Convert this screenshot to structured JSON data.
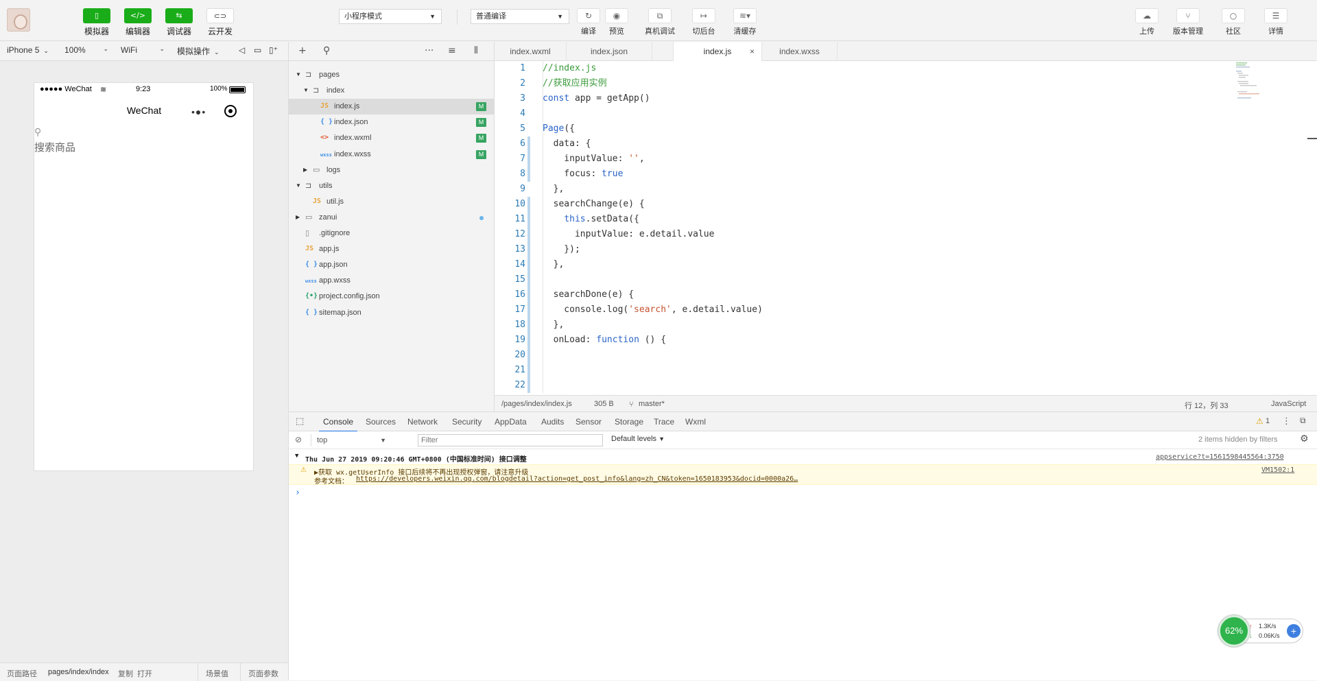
{
  "toolbar": {
    "left_buttons": [
      "模拟器",
      "编辑器",
      "调试器",
      "云开发"
    ],
    "mode_select": "小程序模式",
    "compile_select": "普通编译",
    "mid_buttons": [
      "编译",
      "预览",
      "真机调试",
      "切后台",
      "清缓存"
    ],
    "right_buttons": [
      "上传",
      "版本管理",
      "社区",
      "详情"
    ]
  },
  "simbar": {
    "device": "iPhone 5",
    "zoom": "100%",
    "network": "WiFi",
    "ops": "模拟操作"
  },
  "phone": {
    "carrier": "●●●●● WeChat",
    "time": "9:23",
    "battery": "100%",
    "nav_title": "WeChat",
    "search_placeholder": "搜索商品"
  },
  "bottom": {
    "path_label": "页面路径",
    "path": "pages/index/index",
    "copy": "复制",
    "open": "打开",
    "scene": "场景值",
    "params": "页面参数"
  },
  "files": [
    {
      "name": "pages",
      "type": "folder-open",
      "depth": 0,
      "tri": "▼"
    },
    {
      "name": "index",
      "type": "folder-open",
      "depth": 1,
      "tri": "▼"
    },
    {
      "name": "index.js",
      "type": "js",
      "depth": 2,
      "badge": "M",
      "active": true
    },
    {
      "name": "index.json",
      "type": "json",
      "depth": 2,
      "badge": "M"
    },
    {
      "name": "index.wxml",
      "type": "wxml",
      "depth": 2,
      "badge": "M"
    },
    {
      "name": "index.wxss",
      "type": "wxss",
      "depth": 2,
      "badge": "M"
    },
    {
      "name": "logs",
      "type": "folder",
      "depth": 1,
      "tri": "▶"
    },
    {
      "name": "utils",
      "type": "folder-open",
      "depth": 0,
      "tri": "▼"
    },
    {
      "name": "util.js",
      "type": "js",
      "depth": 1
    },
    {
      "name": "zanui",
      "type": "folder",
      "depth": 0,
      "tri": "▶",
      "dot": true
    },
    {
      "name": ".gitignore",
      "type": "file",
      "depth": 0
    },
    {
      "name": "app.js",
      "type": "js",
      "depth": 0
    },
    {
      "name": "app.json",
      "type": "json",
      "depth": 0
    },
    {
      "name": "app.wxss",
      "type": "wxss",
      "depth": 0
    },
    {
      "name": "project.config.json",
      "type": "config",
      "depth": 0
    },
    {
      "name": "sitemap.json",
      "type": "json",
      "depth": 0
    }
  ],
  "tabs": [
    "index.wxml",
    "index.json",
    "index.js",
    "index.wxss"
  ],
  "active_tab": "index.js",
  "code_lines": [
    {
      "n": "1",
      "t": "//index.js",
      "k": "cm"
    },
    {
      "n": "2",
      "t": "//获取应用实例",
      "k": "cm"
    },
    {
      "n": "3",
      "t": "const app = getApp()",
      "k": "mix"
    },
    {
      "n": "4",
      "t": "",
      "k": ""
    },
    {
      "n": "5",
      "t": "Page({",
      "k": "kw"
    },
    {
      "n": "6",
      "t": "  data: {",
      "k": ""
    },
    {
      "n": "7",
      "t": "    inputValue: '',",
      "k": ""
    },
    {
      "n": "8",
      "t": "    focus: true",
      "k": ""
    },
    {
      "n": "9",
      "t": "  },",
      "k": ""
    },
    {
      "n": "10",
      "t": "  searchChange(e) {",
      "k": ""
    },
    {
      "n": "11",
      "t": "    this.setData({",
      "k": ""
    },
    {
      "n": "12",
      "t": "      inputValue: e.detail.value",
      "k": ""
    },
    {
      "n": "13",
      "t": "    });",
      "k": ""
    },
    {
      "n": "14",
      "t": "  },",
      "k": ""
    },
    {
      "n": "15",
      "t": "",
      "k": ""
    },
    {
      "n": "16",
      "t": "  searchDone(e) {",
      "k": ""
    },
    {
      "n": "17",
      "t": "    console.log('search', e.detail.value)",
      "k": ""
    },
    {
      "n": "18",
      "t": "  },",
      "k": ""
    },
    {
      "n": "19",
      "t": "  onLoad: function () {",
      "k": ""
    },
    {
      "n": "20",
      "t": "",
      "k": ""
    },
    {
      "n": "21",
      "t": "",
      "k": ""
    },
    {
      "n": "22",
      "t": "",
      "k": ""
    }
  ],
  "editor_status": {
    "path": "/pages/index/index.js",
    "size": "305 B",
    "branch": "master*",
    "position": "行 12，列 33",
    "language": "JavaScript"
  },
  "devtools": {
    "tabs": [
      "Console",
      "Sources",
      "Network",
      "Security",
      "AppData",
      "Audits",
      "Sensor",
      "Storage",
      "Trace",
      "Wxml"
    ],
    "active_tab": "Console",
    "warn_count": "1",
    "context": "top",
    "filter_placeholder": "Filter",
    "levels": "Default levels",
    "hidden": "2 items hidden by filters",
    "group_line": "Thu Jun 27 2019 09:20:46 GMT+0800 (中国标准时间) 接口调整",
    "group_source": "appservice?t=1561598445564:3750",
    "warn_line1": "▶获取 wx.getUserInfo 接口后续将不再出现授权弹窗，请注意升级",
    "warn_line2": "参考文档：",
    "warn_link": "https://developers.weixin.qq.com/blogdetail?action=get_post_info&lang=zh_CN&token=1650183953&docid=0000a26…",
    "warn_source": "VM1502:1",
    "prompt": "›"
  },
  "net_widget": {
    "percent": "62%",
    "up": "1.3K/s",
    "down": "0.06K/s"
  }
}
